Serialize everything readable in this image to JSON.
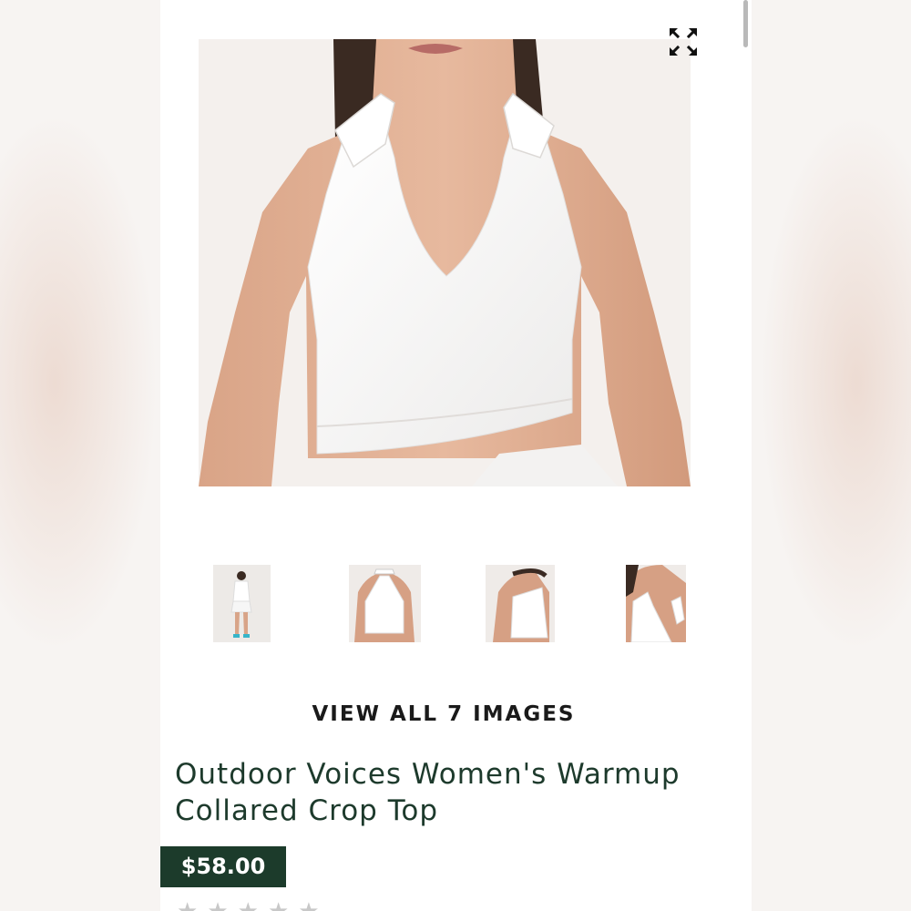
{
  "gallery": {
    "expand_icon": "expand-arrows-icon",
    "main_image": "white collared halter crop top front view",
    "thumbnails": [
      {
        "label": "full-body model view"
      },
      {
        "label": "back view"
      },
      {
        "label": "side view"
      },
      {
        "label": "collar detail view"
      }
    ],
    "view_all_label": "VIEW ALL 7 IMAGES"
  },
  "product": {
    "title": "Outdoor Voices Women's Warmup Collared Crop Top",
    "price": "$58.00",
    "rating_stars": 0,
    "rating_max": 5
  },
  "colors": {
    "title": "#1d3a2c",
    "price_bg": "#1c3b2b",
    "star_empty": "#c8c8c8"
  }
}
